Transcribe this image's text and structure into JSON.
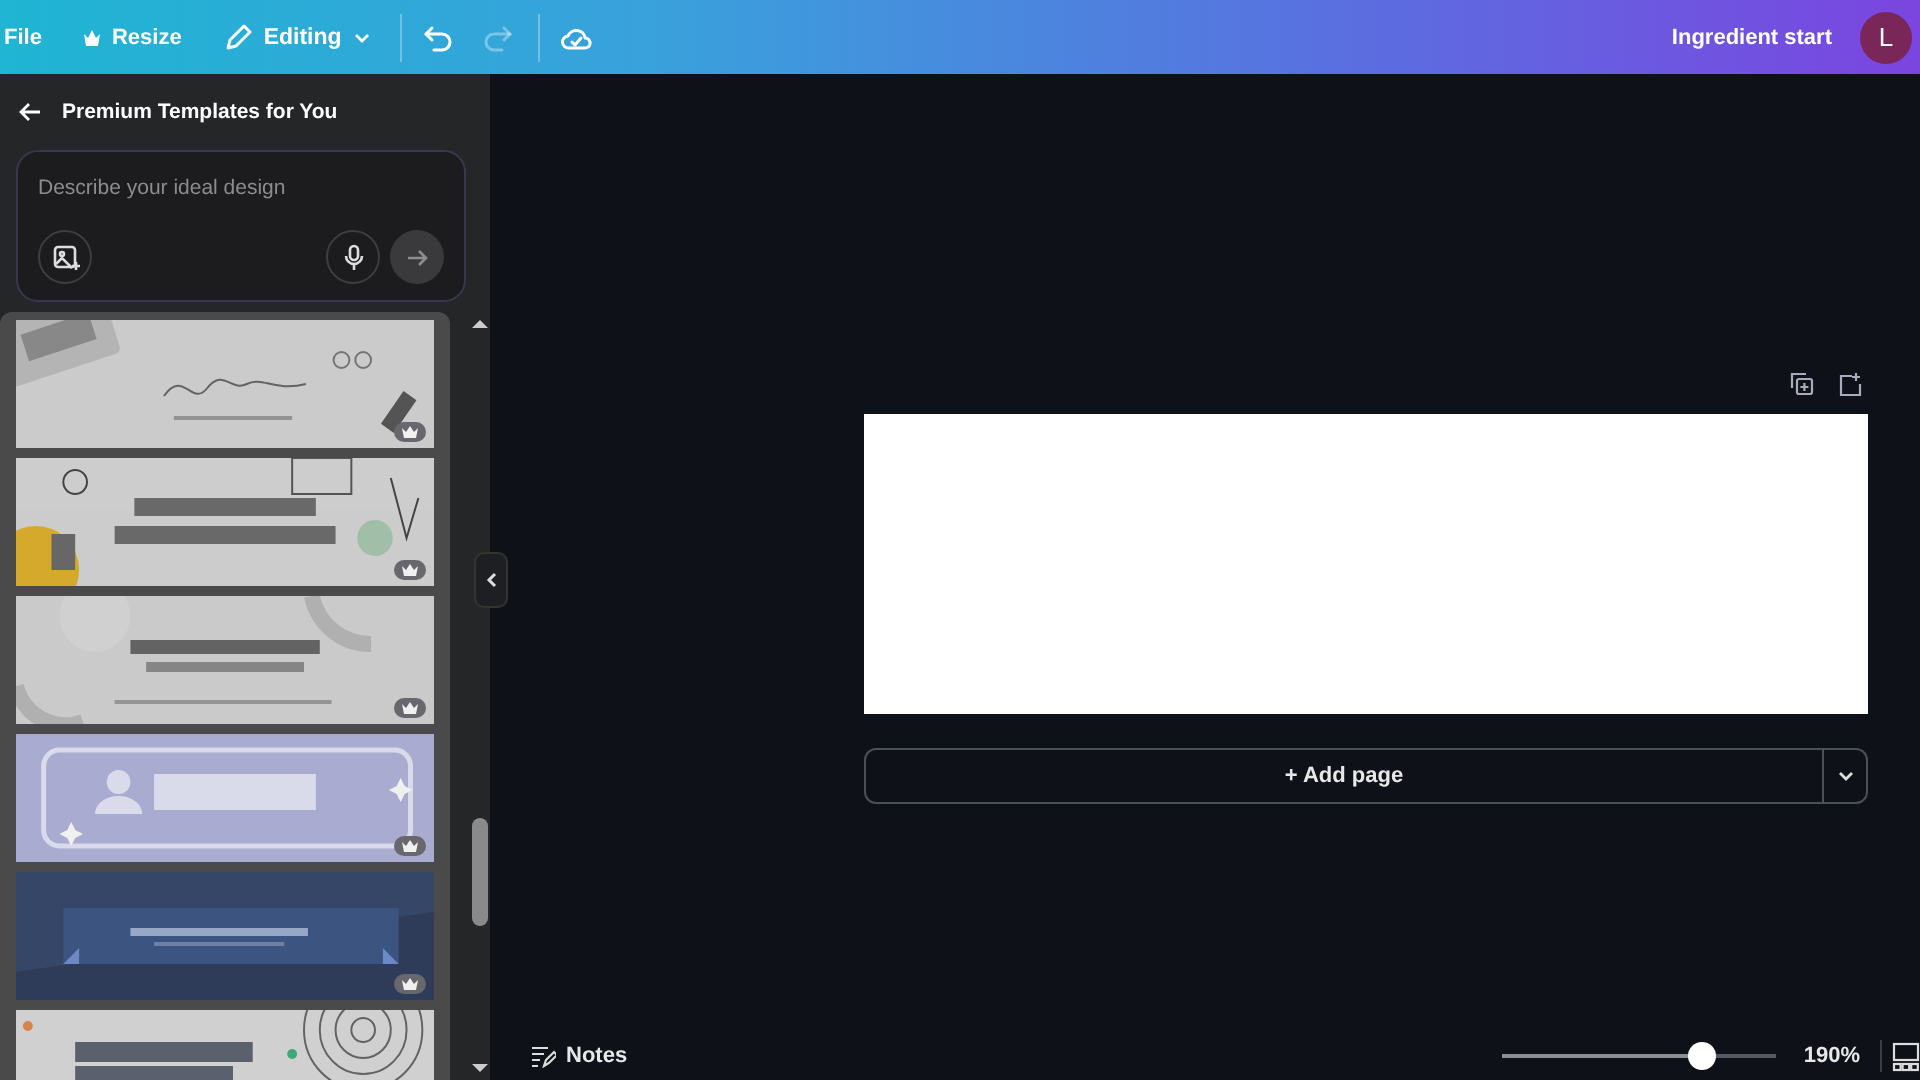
{
  "topbar": {
    "menu": [
      {
        "kind": "file",
        "label": "File"
      },
      {
        "kind": "resize",
        "label": "Resize"
      },
      {
        "kind": "editing",
        "label": "Editing"
      }
    ],
    "undo": {
      "disabled": false
    },
    "redo": {
      "disabled": true
    },
    "title": "Ingredient start",
    "avatar": "L"
  },
  "sidebar": {
    "title": "Premium Templates for You",
    "prompt": {
      "placeholder": "Describe your ideal design"
    },
    "templates": [
      {
        "kind": "picture",
        "premium": true
      },
      {
        "kind": "picture",
        "premium": true
      },
      {
        "kind": "picture",
        "premium": true
      },
      {
        "kind": "picture",
        "premium": true
      },
      {
        "kind": "picture",
        "premium": true
      },
      {
        "kind": "picture"
      }
    ]
  },
  "canvas": {
    "add_page": "+ Add page"
  },
  "bottom_bar": {
    "notes": "Notes",
    "zoom": {
      "level": 0.73
    },
    "zoom_reading": "190%"
  }
}
